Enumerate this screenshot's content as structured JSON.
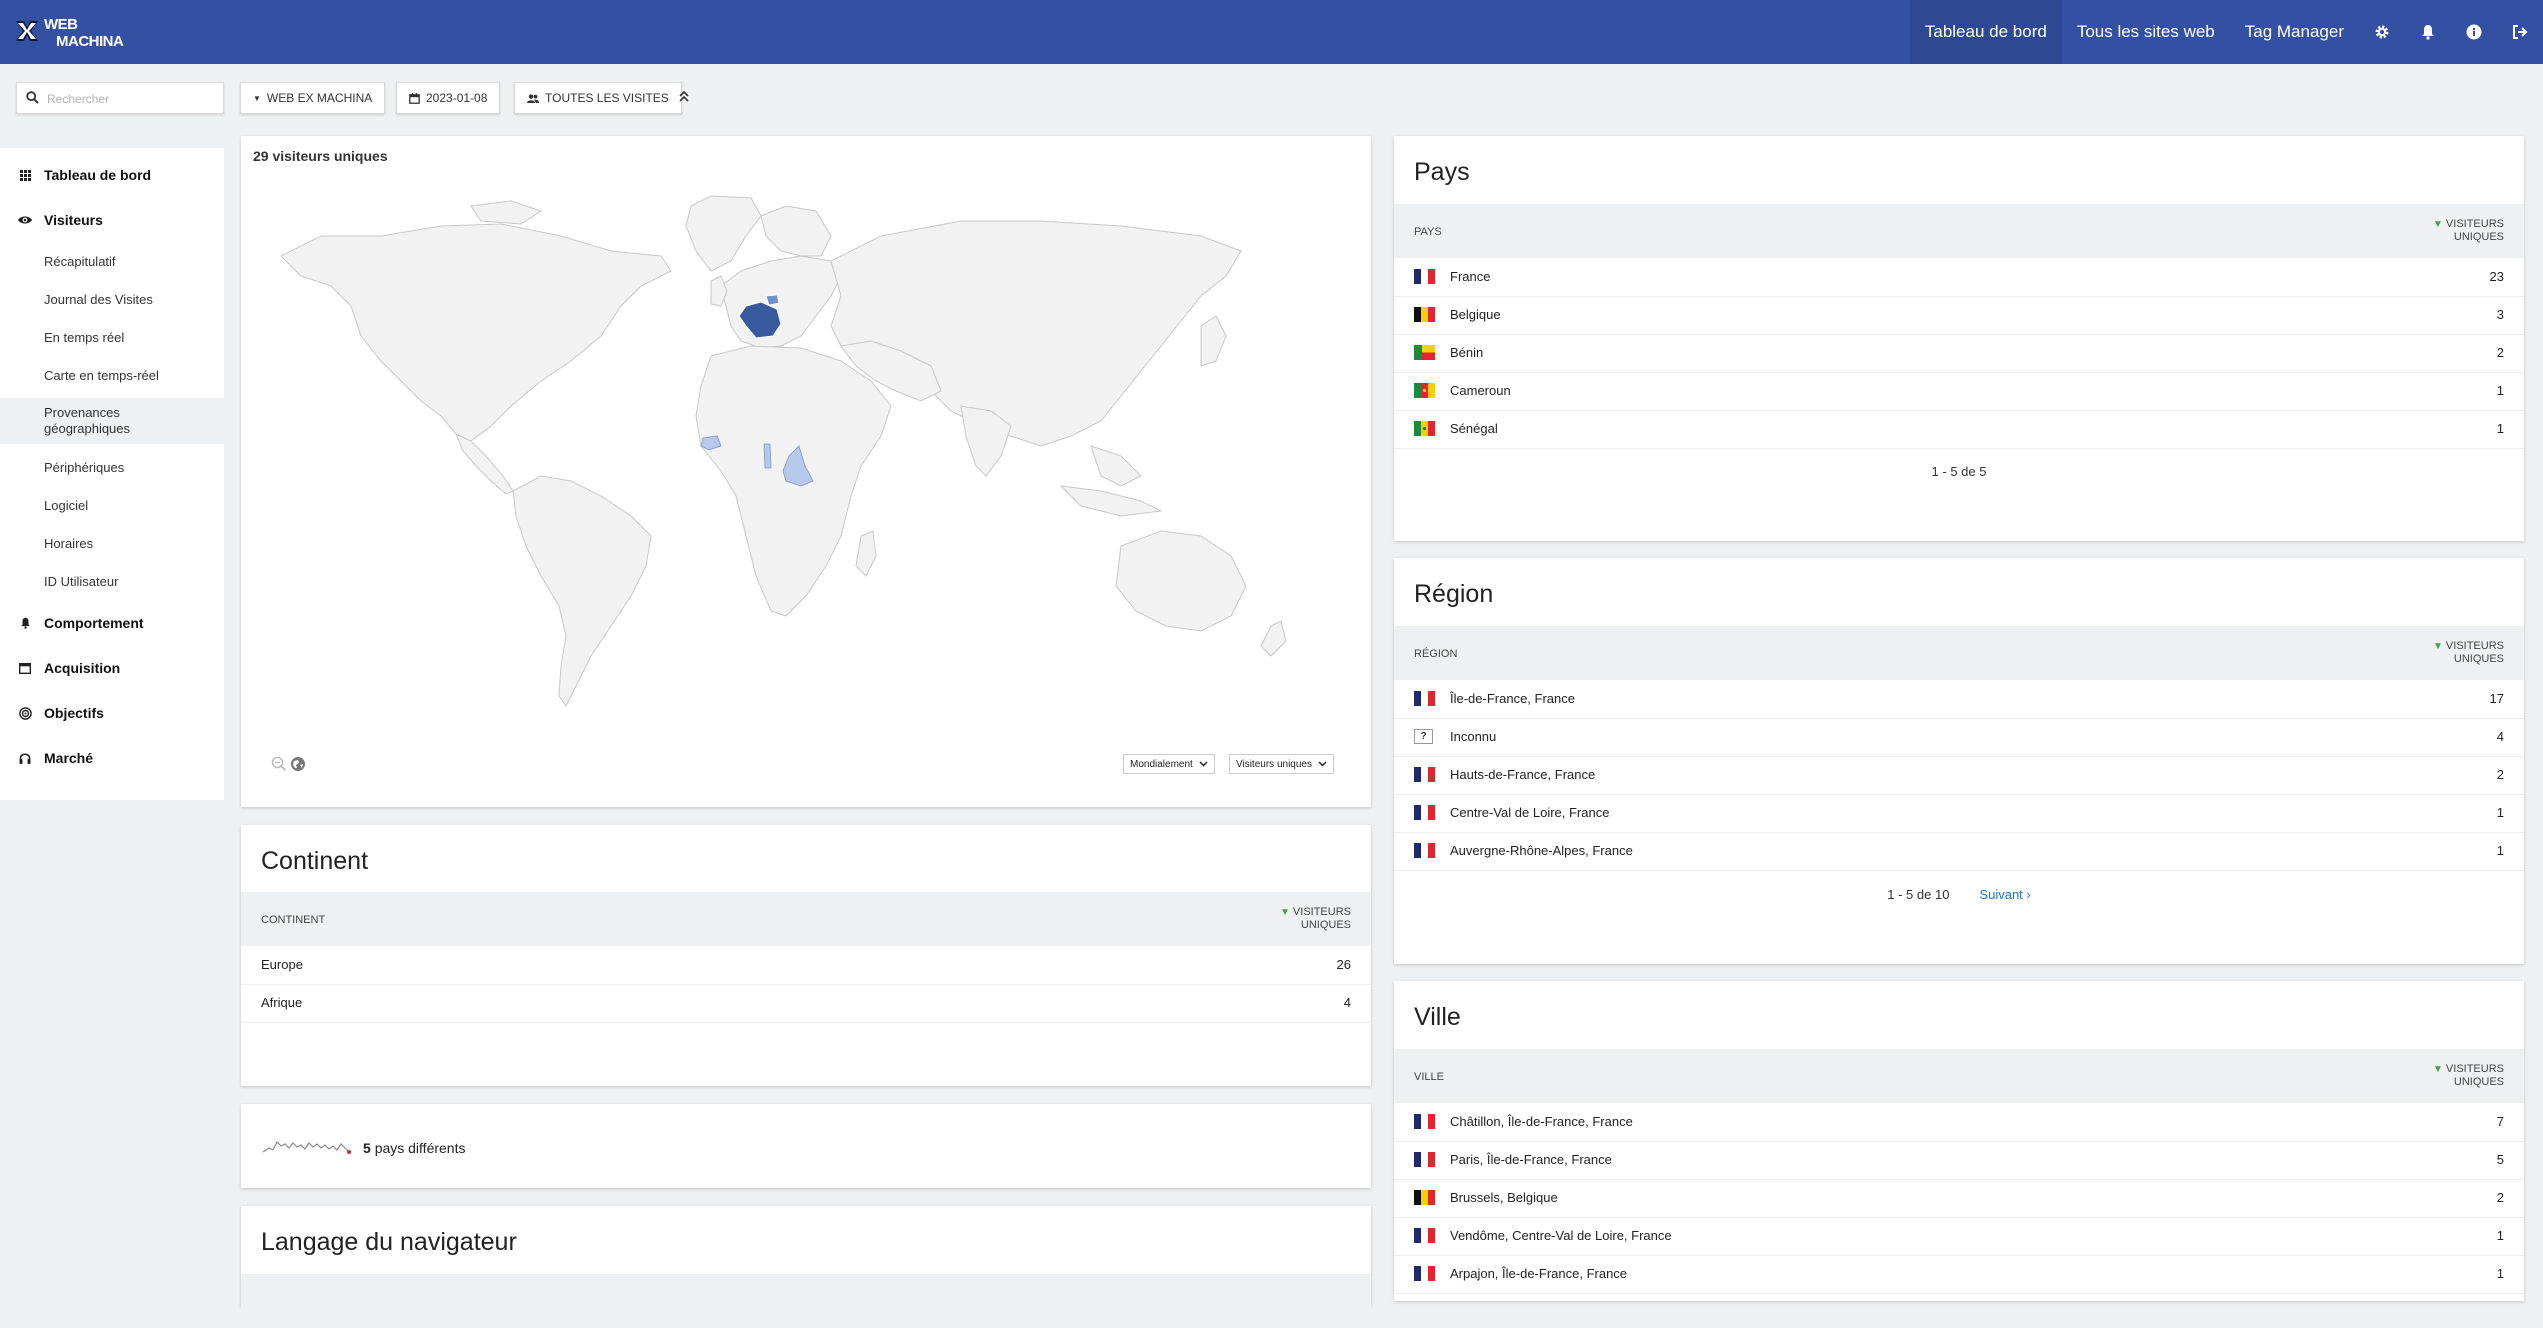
{
  "brand": {
    "line1": "WEB",
    "line2": "MACHINA"
  },
  "nav": {
    "items": [
      {
        "label": "Tableau de bord",
        "active": true
      },
      {
        "label": "Tous les sites web",
        "active": false
      },
      {
        "label": "Tag Manager",
        "active": false
      }
    ],
    "icons": [
      "gear-icon",
      "bell-icon",
      "info-icon",
      "logout-icon"
    ]
  },
  "toolbar": {
    "search_placeholder": "Rechercher",
    "site": "WEB EX MACHINA",
    "date": "2023-01-08",
    "segment": "TOUTES LES VISITES"
  },
  "sidebar": {
    "main": [
      {
        "label": "Tableau de bord",
        "icon": "dashboard-icon"
      },
      {
        "label": "Visiteurs",
        "icon": "visitors-icon"
      },
      {
        "label": "Comportement",
        "icon": "bell-icon"
      },
      {
        "label": "Acquisition",
        "icon": "acquisition-icon"
      },
      {
        "label": "Objectifs",
        "icon": "target-icon"
      },
      {
        "label": "Marché",
        "icon": "headphones-icon"
      }
    ],
    "sub": [
      {
        "label": "Récapitulatif"
      },
      {
        "label": "Journal des Visites"
      },
      {
        "label": "En temps réel"
      },
      {
        "label": "Carte en temps-réel"
      },
      {
        "label": "Provenances géographiques",
        "active": true
      },
      {
        "label": "Périphériques"
      },
      {
        "label": "Logiciel"
      },
      {
        "label": "Horaires"
      },
      {
        "label": "ID Utilisateur"
      }
    ]
  },
  "map": {
    "title": "29 visiteurs uniques",
    "region_select": "Mondialement",
    "metric_select": "Visiteurs uniques",
    "colors": {
      "land": "#f2f2f2",
      "border": "#c8c8c8",
      "high": "#3a5aa0",
      "low": "#b7c9ea",
      "mid": "#6f8fd0"
    }
  },
  "continent": {
    "title": "Continent",
    "col_label": "CONTINENT",
    "col_value_line1": "VISITEURS",
    "col_value_line2": "UNIQUES",
    "rows": [
      {
        "label": "Europe",
        "value": "26"
      },
      {
        "label": "Afrique",
        "value": "4"
      }
    ]
  },
  "countries_summary": {
    "count": "5",
    "text": "pays différents"
  },
  "langage": {
    "title": "Langage du navigateur"
  },
  "pays": {
    "title": "Pays",
    "col_label": "PAYS",
    "col_value_line1": "VISITEURS",
    "col_value_line2": "UNIQUES",
    "rows": [
      {
        "label": "France",
        "value": "23",
        "flag": "fr"
      },
      {
        "label": "Belgique",
        "value": "3",
        "flag": "be"
      },
      {
        "label": "Bénin",
        "value": "2",
        "flag": "bj"
      },
      {
        "label": "Cameroun",
        "value": "1",
        "flag": "cm"
      },
      {
        "label": "Sénégal",
        "value": "1",
        "flag": "sn"
      }
    ],
    "pager": "1 - 5 de 5"
  },
  "region": {
    "title": "Région",
    "col_label": "RÉGION",
    "col_value_line1": "VISITEURS",
    "col_value_line2": "UNIQUES",
    "rows": [
      {
        "label": "Île-de-France, France",
        "value": "17",
        "flag": "fr"
      },
      {
        "label": "Inconnu",
        "value": "4",
        "flag": "unknown"
      },
      {
        "label": "Hauts-de-France, France",
        "value": "2",
        "flag": "fr"
      },
      {
        "label": "Centre-Val de Loire, France",
        "value": "1",
        "flag": "fr"
      },
      {
        "label": "Auvergne-Rhône-Alpes, France",
        "value": "1",
        "flag": "fr"
      }
    ],
    "pager": "1 - 5 de 10",
    "next": "Suivant ›"
  },
  "ville": {
    "title": "Ville",
    "col_label": "VILLE",
    "col_value_line1": "VISITEURS",
    "col_value_line2": "UNIQUES",
    "rows": [
      {
        "label": "Châtillon, Île-de-France, France",
        "value": "7",
        "flag": "fr"
      },
      {
        "label": "Paris, Île-de-France, France",
        "value": "5",
        "flag": "fr"
      },
      {
        "label": "Brussels, Belgique",
        "value": "2",
        "flag": "be"
      },
      {
        "label": "Vendôme, Centre-Val de Loire, France",
        "value": "1",
        "flag": "fr"
      },
      {
        "label": "Arpajon, Île-de-France, France",
        "value": "1",
        "flag": "fr"
      }
    ]
  }
}
